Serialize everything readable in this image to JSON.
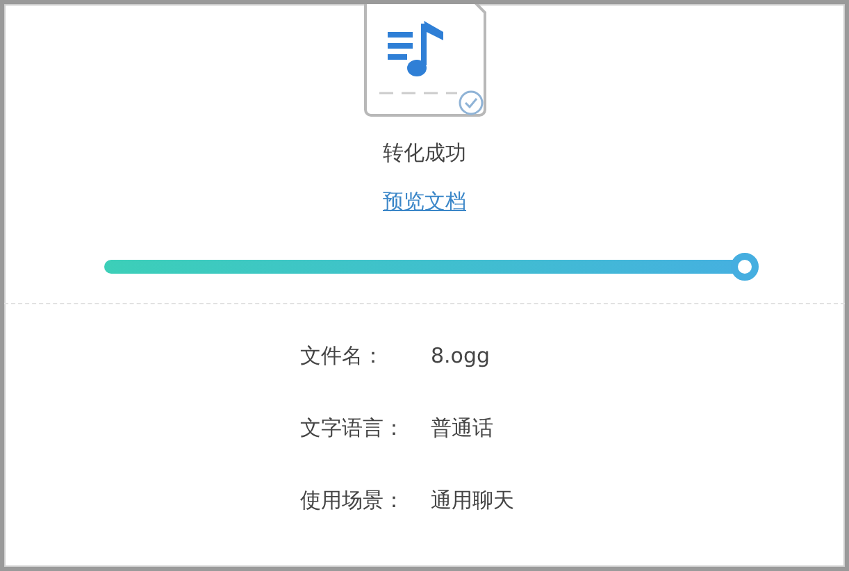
{
  "status": "转化成功",
  "preview_link": "预览文档",
  "progress": {
    "level": 1
  },
  "details": [
    {
      "label": "文件名：",
      "value": "8.ogg"
    },
    {
      "label": "文字语言：",
      "value": "普通话"
    },
    {
      "label": "使用场景：",
      "value": "通用聊天"
    }
  ]
}
